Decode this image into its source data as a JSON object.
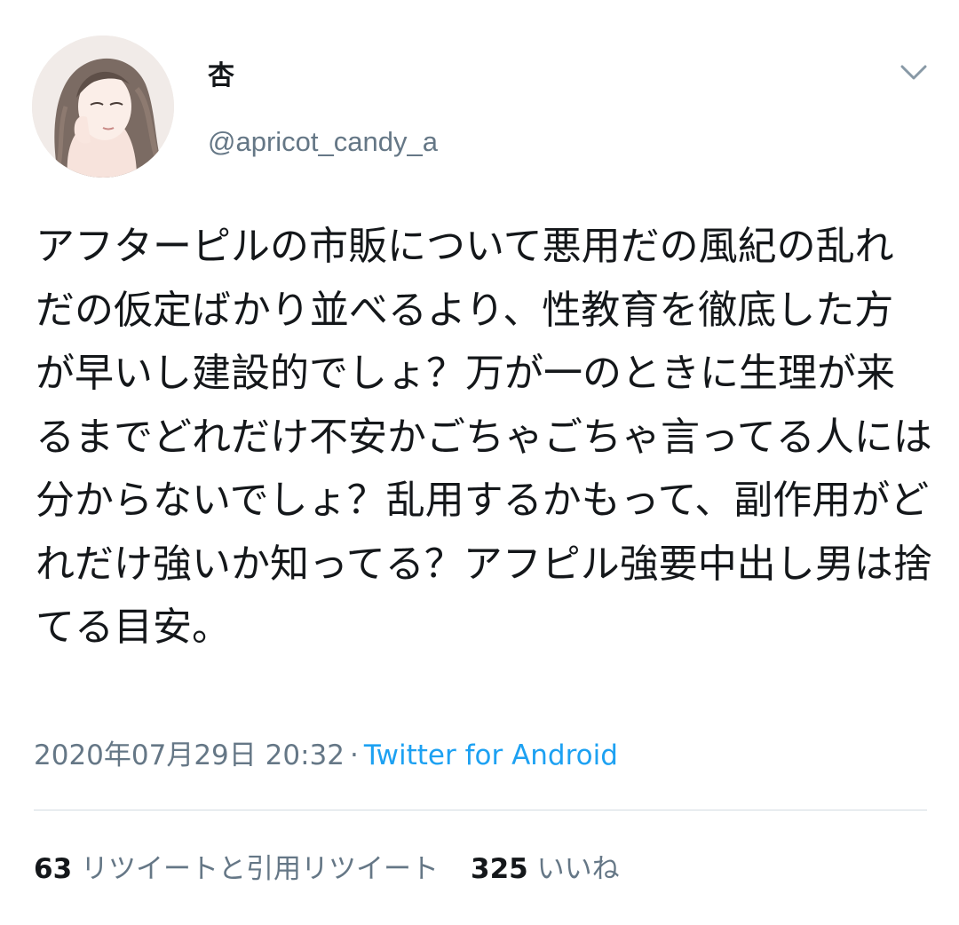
{
  "author": {
    "display_name": "杏",
    "handle": "@apricot_candy_a",
    "avatar_icon": "avatar-illustration"
  },
  "menu_icon": "chevron-down-icon",
  "tweet": {
    "text": "アフターピルの市販について悪用だの風紀の乱れだの仮定ばかり並べるより、性教育を徹底した方が早いし建設的でしょ？万が一のときに生理が来るまでどれだけ不安かごちゃごちゃ言ってる人には分からないでしょ？乱用するかもって、副作用がどれだけ強いか知ってる？アフピル強要中出し男は捨てる目安。",
    "timestamp": "2020年07月29日 20:32",
    "separator": "·",
    "source": "Twitter for Android"
  },
  "stats": {
    "retweets_count": "63",
    "retweets_label": "リツイートと引用リツイート",
    "likes_count": "325",
    "likes_label": "いいね"
  },
  "colors": {
    "text": "#14171a",
    "secondary": "#657786",
    "link": "#1da1f2",
    "divider": "#d3dbe2"
  }
}
